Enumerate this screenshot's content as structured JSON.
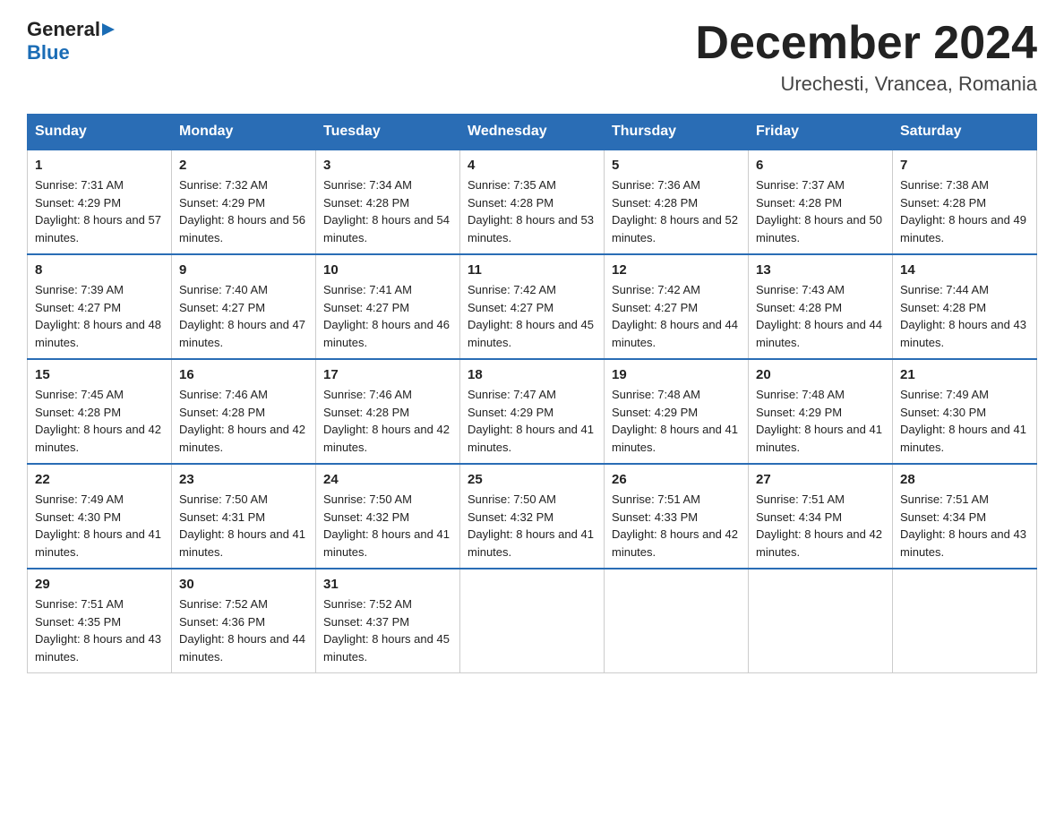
{
  "header": {
    "logo_general": "General",
    "logo_blue": "Blue",
    "month_title": "December 2024",
    "location": "Urechesti, Vrancea, Romania"
  },
  "days_of_week": [
    "Sunday",
    "Monday",
    "Tuesday",
    "Wednesday",
    "Thursday",
    "Friday",
    "Saturday"
  ],
  "weeks": [
    [
      {
        "day": "1",
        "sunrise": "7:31 AM",
        "sunset": "4:29 PM",
        "daylight": "8 hours and 57 minutes."
      },
      {
        "day": "2",
        "sunrise": "7:32 AM",
        "sunset": "4:29 PM",
        "daylight": "8 hours and 56 minutes."
      },
      {
        "day": "3",
        "sunrise": "7:34 AM",
        "sunset": "4:28 PM",
        "daylight": "8 hours and 54 minutes."
      },
      {
        "day": "4",
        "sunrise": "7:35 AM",
        "sunset": "4:28 PM",
        "daylight": "8 hours and 53 minutes."
      },
      {
        "day": "5",
        "sunrise": "7:36 AM",
        "sunset": "4:28 PM",
        "daylight": "8 hours and 52 minutes."
      },
      {
        "day": "6",
        "sunrise": "7:37 AM",
        "sunset": "4:28 PM",
        "daylight": "8 hours and 50 minutes."
      },
      {
        "day": "7",
        "sunrise": "7:38 AM",
        "sunset": "4:28 PM",
        "daylight": "8 hours and 49 minutes."
      }
    ],
    [
      {
        "day": "8",
        "sunrise": "7:39 AM",
        "sunset": "4:27 PM",
        "daylight": "8 hours and 48 minutes."
      },
      {
        "day": "9",
        "sunrise": "7:40 AM",
        "sunset": "4:27 PM",
        "daylight": "8 hours and 47 minutes."
      },
      {
        "day": "10",
        "sunrise": "7:41 AM",
        "sunset": "4:27 PM",
        "daylight": "8 hours and 46 minutes."
      },
      {
        "day": "11",
        "sunrise": "7:42 AM",
        "sunset": "4:27 PM",
        "daylight": "8 hours and 45 minutes."
      },
      {
        "day": "12",
        "sunrise": "7:42 AM",
        "sunset": "4:27 PM",
        "daylight": "8 hours and 44 minutes."
      },
      {
        "day": "13",
        "sunrise": "7:43 AM",
        "sunset": "4:28 PM",
        "daylight": "8 hours and 44 minutes."
      },
      {
        "day": "14",
        "sunrise": "7:44 AM",
        "sunset": "4:28 PM",
        "daylight": "8 hours and 43 minutes."
      }
    ],
    [
      {
        "day": "15",
        "sunrise": "7:45 AM",
        "sunset": "4:28 PM",
        "daylight": "8 hours and 42 minutes."
      },
      {
        "day": "16",
        "sunrise": "7:46 AM",
        "sunset": "4:28 PM",
        "daylight": "8 hours and 42 minutes."
      },
      {
        "day": "17",
        "sunrise": "7:46 AM",
        "sunset": "4:28 PM",
        "daylight": "8 hours and 42 minutes."
      },
      {
        "day": "18",
        "sunrise": "7:47 AM",
        "sunset": "4:29 PM",
        "daylight": "8 hours and 41 minutes."
      },
      {
        "day": "19",
        "sunrise": "7:48 AM",
        "sunset": "4:29 PM",
        "daylight": "8 hours and 41 minutes."
      },
      {
        "day": "20",
        "sunrise": "7:48 AM",
        "sunset": "4:29 PM",
        "daylight": "8 hours and 41 minutes."
      },
      {
        "day": "21",
        "sunrise": "7:49 AM",
        "sunset": "4:30 PM",
        "daylight": "8 hours and 41 minutes."
      }
    ],
    [
      {
        "day": "22",
        "sunrise": "7:49 AM",
        "sunset": "4:30 PM",
        "daylight": "8 hours and 41 minutes."
      },
      {
        "day": "23",
        "sunrise": "7:50 AM",
        "sunset": "4:31 PM",
        "daylight": "8 hours and 41 minutes."
      },
      {
        "day": "24",
        "sunrise": "7:50 AM",
        "sunset": "4:32 PM",
        "daylight": "8 hours and 41 minutes."
      },
      {
        "day": "25",
        "sunrise": "7:50 AM",
        "sunset": "4:32 PM",
        "daylight": "8 hours and 41 minutes."
      },
      {
        "day": "26",
        "sunrise": "7:51 AM",
        "sunset": "4:33 PM",
        "daylight": "8 hours and 42 minutes."
      },
      {
        "day": "27",
        "sunrise": "7:51 AM",
        "sunset": "4:34 PM",
        "daylight": "8 hours and 42 minutes."
      },
      {
        "day": "28",
        "sunrise": "7:51 AM",
        "sunset": "4:34 PM",
        "daylight": "8 hours and 43 minutes."
      }
    ],
    [
      {
        "day": "29",
        "sunrise": "7:51 AM",
        "sunset": "4:35 PM",
        "daylight": "8 hours and 43 minutes."
      },
      {
        "day": "30",
        "sunrise": "7:52 AM",
        "sunset": "4:36 PM",
        "daylight": "8 hours and 44 minutes."
      },
      {
        "day": "31",
        "sunrise": "7:52 AM",
        "sunset": "4:37 PM",
        "daylight": "8 hours and 45 minutes."
      },
      null,
      null,
      null,
      null
    ]
  ]
}
